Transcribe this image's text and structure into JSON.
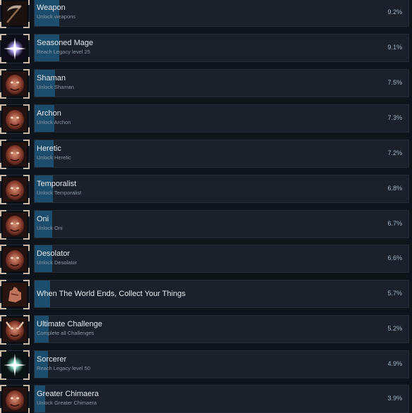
{
  "colors": {
    "background": "#0f141b",
    "bar_bg": "#1a212a",
    "bar_fill": "#1c4d6c",
    "title_text": "#e6eaee",
    "desc_text": "#8a96a3",
    "pct_text": "#9fb2c4"
  },
  "achievements": [
    {
      "icon": "scythe-weapon-icon",
      "title": "Weapon",
      "desc": "Unlock weapons",
      "percent": "9.2%",
      "fill": 0.092
    },
    {
      "icon": "violet-star-icon",
      "title": "Seasoned Mage",
      "desc": "Reach Legacy level 25",
      "percent": "9.1%",
      "fill": 0.091
    },
    {
      "icon": "shaman-portrait-icon",
      "title": "Shaman",
      "desc": "Unlock Shaman",
      "percent": "7.5%",
      "fill": 0.075
    },
    {
      "icon": "archon-portrait-icon",
      "title": "Archon",
      "desc": "Unlock Archon",
      "percent": "7.3%",
      "fill": 0.073
    },
    {
      "icon": "heretic-portrait-icon",
      "title": "Heretic",
      "desc": "Unlock Heretic",
      "percent": "7.2%",
      "fill": 0.072
    },
    {
      "icon": "temporalist-portrait-icon",
      "title": "Temporalist",
      "desc": "Unlock Temporalist",
      "percent": "6.8%",
      "fill": 0.068
    },
    {
      "icon": "oni-portrait-icon",
      "title": "Oni",
      "desc": "Unlock Oni",
      "percent": "6.7%",
      "fill": 0.067
    },
    {
      "icon": "desolator-portrait-icon",
      "title": "Desolator",
      "desc": "Unlock Desolator",
      "percent": "6.6%",
      "fill": 0.066
    },
    {
      "icon": "hand-portrait-icon",
      "title": "When The World Ends, Collect Your Things",
      "desc": "",
      "percent": "5.7%",
      "fill": 0.057
    },
    {
      "icon": "demon-portrait-icon",
      "title": "Ultimate Challenge",
      "desc": "Complete all Challenges",
      "percent": "5.2%",
      "fill": 0.052
    },
    {
      "icon": "teal-star-icon",
      "title": "Sorcerer",
      "desc": "Reach Legacy level 50",
      "percent": "4.9%",
      "fill": 0.049
    },
    {
      "icon": "chimaera-portrait-icon",
      "title": "Greater Chimaera",
      "desc": "Unlock Greater Chimaera",
      "percent": "3.9%",
      "fill": 0.039
    }
  ]
}
